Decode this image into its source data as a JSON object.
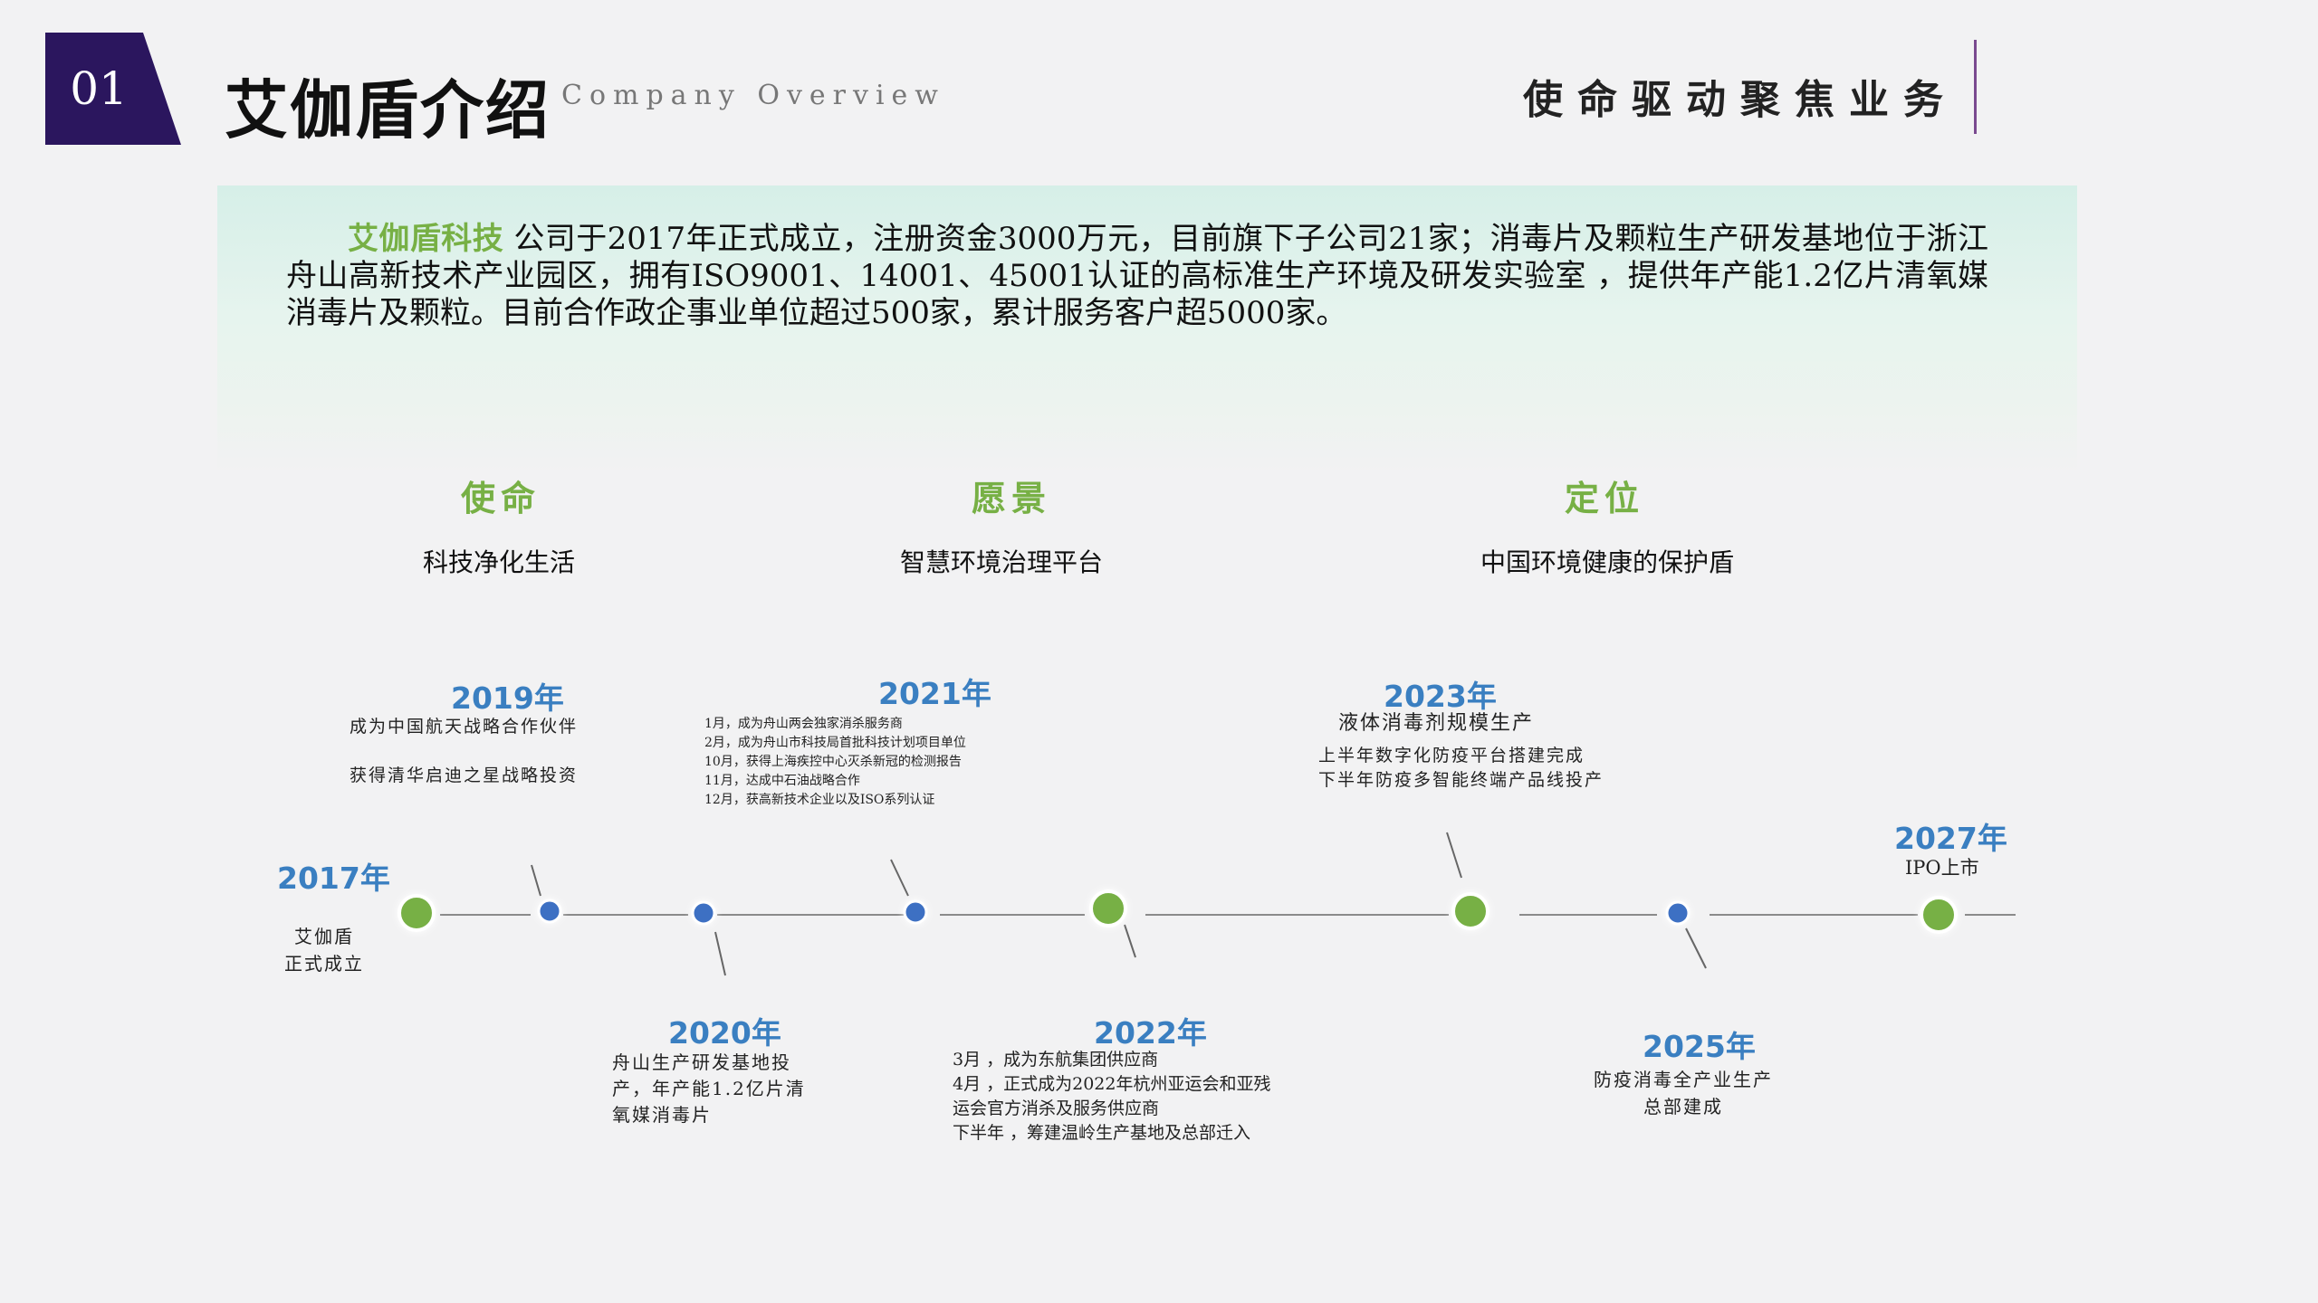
{
  "header": {
    "badge": "01",
    "title": "艾伽盾介绍",
    "subtitle": "Company Overview",
    "slogan": "使命驱动聚焦业务"
  },
  "intro": {
    "highlight": "艾伽盾科技",
    "text": "公司于2017年正式成立，注册资金3000万元，目前旗下子公司21家；消毒片及颗粒生产研发基地位于浙江舟山高新技术产业园区，拥有ISO9001、14001、45001认证的高标准生产环境及研发实验室 ，提供年产能1.2亿片清氧媒消毒片及颗粒。目前合作政企事业单位超过500家，累计服务客户超5000家。"
  },
  "pillars": [
    {
      "heading": "使命",
      "text": "科技净化生活"
    },
    {
      "heading": "愿景",
      "text": "智慧环境治理平台"
    },
    {
      "heading": "定位",
      "text": "中国环境健康的保护盾"
    }
  ],
  "timeline": {
    "events": [
      {
        "year": "2017年",
        "note": "艾伽盾\n正式成立"
      },
      {
        "year": "2019年",
        "note": "成为中国航天战略合作伙伴\n\n获得清华启迪之星战略投资"
      },
      {
        "year": "2020年",
        "note": "舟山生产研发基地投\n产，年产能1.2亿片清\n氧媒消毒片"
      },
      {
        "year": "2021年",
        "note": "1月，成为舟山两会独家消杀服务商\n2月，成为舟山市科技局首批科技计划项目单位\n10月，获得上海疾控中心灭杀新冠的检测报告\n11月，达成中石油战略合作\n12月，获高新技术企业以及ISO系列认证"
      },
      {
        "year": "2022年",
        "note": "3月 ，成为东航集团供应商\n4月 ，正式成为2022年杭州亚运会和亚残\n运会官方消杀及服务供应商\n下半年 ，筹建温岭生产基地及总部迁入"
      },
      {
        "year": "2023年",
        "note_title": "液体消毒剂规模生产",
        "note": "上半年数字化防疫平台搭建完成\n下半年防疫多智能终端产品线投产"
      },
      {
        "year": "2025年",
        "note": "防疫消毒全产业生产\n总部建成"
      },
      {
        "year": "2027年",
        "note": "IPO上市"
      }
    ]
  },
  "colors": {
    "badge": "#2b165e",
    "green_accent": "#77b045",
    "blue_accent": "#3a7fc1",
    "slogan_bar": "#7a4a8f",
    "timeline_line": "#8a8a8a"
  }
}
